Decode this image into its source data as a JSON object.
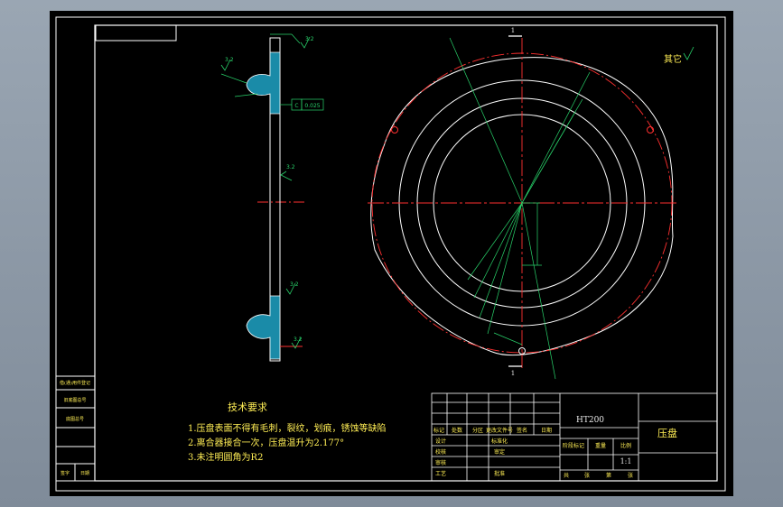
{
  "tech_requirements": {
    "heading": "技术要求",
    "items": [
      "1.压盘表面不得有毛刺，裂纹，划痕，锈蚀等缺陷",
      "2.离合器接合一次，压盘温升为2.177°",
      "3.未注明圆角为R2"
    ]
  },
  "surface_note": "其它",
  "material": "HT200",
  "part_name": "压盘",
  "scale": "1:1",
  "section_label": "1",
  "flatness_callout": "0.025",
  "datum_letter": "C",
  "roughness_marks": [
    "3.2",
    "3.2",
    "3.2",
    "3.2",
    "3.2"
  ],
  "title_block": {
    "row_labels": [
      "标记",
      "处数",
      "分区",
      "更改文件号",
      "签名",
      "日期"
    ],
    "left_column": [
      "设计",
      "校核",
      "审核",
      "工艺"
    ],
    "mid_column": [
      "标准化",
      "审定",
      "批准"
    ],
    "stage_headers": [
      "阶段标记",
      "重量",
      "比例"
    ],
    "footer": [
      "共",
      "张",
      "第",
      "张"
    ]
  },
  "side_table": [
    "借(通)用件登记",
    "旧底图总号",
    "底图总号",
    "签字",
    "日期"
  ],
  "colors": {
    "background": "#000000",
    "border": "#ffffff",
    "section_hatch": "#1a8ba8",
    "centerline": "#ff3030",
    "dimension": "#29d36b",
    "text": "#ffee55"
  }
}
